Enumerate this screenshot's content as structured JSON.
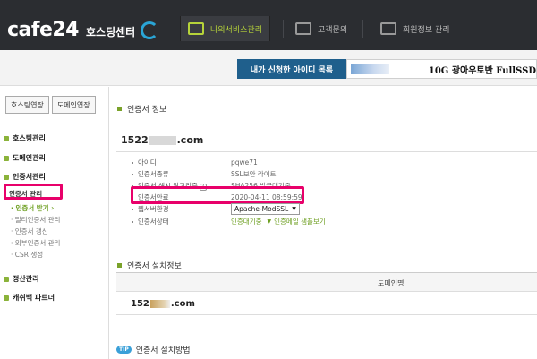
{
  "header": {
    "logo_text": "cafe24",
    "logo_sub": "호스팅센터",
    "nav": [
      {
        "label": "나의서비스관리",
        "icon": "monitor-settings-icon",
        "active": true
      },
      {
        "label": "고객문의",
        "icon": "support-monitor-icon",
        "active": false
      },
      {
        "label": "회원정보 관리",
        "icon": "member-info-icon",
        "active": false
      }
    ]
  },
  "idbar": {
    "label": "내가 신청한 아이디 목록",
    "value": "10G 광아우토반 FullSSD"
  },
  "sidebar": {
    "buttons": [
      "호스팅연장",
      "도메인연장"
    ],
    "menus": [
      {
        "label": "호스팅관리"
      },
      {
        "label": "도메인관리"
      },
      {
        "label": "인증서관리"
      }
    ],
    "cert_sub": [
      "인증서 관리"
    ],
    "cert_children": [
      "· 인증서 받기 ›",
      "· 멀티인증서 관리",
      "· 인증서 갱신",
      "· 외부인증서 관리",
      "· CSR 생성"
    ],
    "menus_bottom": [
      {
        "label": "정산관리"
      },
      {
        "label": "캐쉬백 파트너"
      }
    ]
  },
  "cert_info": {
    "title": "인증서 정보",
    "domain_prefix": "1522",
    "domain_suffix": ".com",
    "rows": [
      {
        "label": "아이디",
        "value": "pqwe71"
      },
      {
        "label": "인증서종류",
        "value": "SSL보안 라이트"
      },
      {
        "label": "인증서 해시 알고리즘",
        "value": "SHA256 발급대기중"
      },
      {
        "label": "인증서만료",
        "value": "2020-04-11 08:59:59"
      },
      {
        "label": "웹서버환경",
        "value": "Apache-ModSSL"
      },
      {
        "label": "인증서상태",
        "value": "인증대기중",
        "extra": "인증메일 샘플보기"
      }
    ]
  },
  "install_info": {
    "title": "인증서 설치정보",
    "col_header": "도메인명",
    "domain_prefix": "152",
    "domain_suffix": ".com"
  },
  "install_method": {
    "badge": "TIP",
    "title": "인증서 설치방법"
  }
}
